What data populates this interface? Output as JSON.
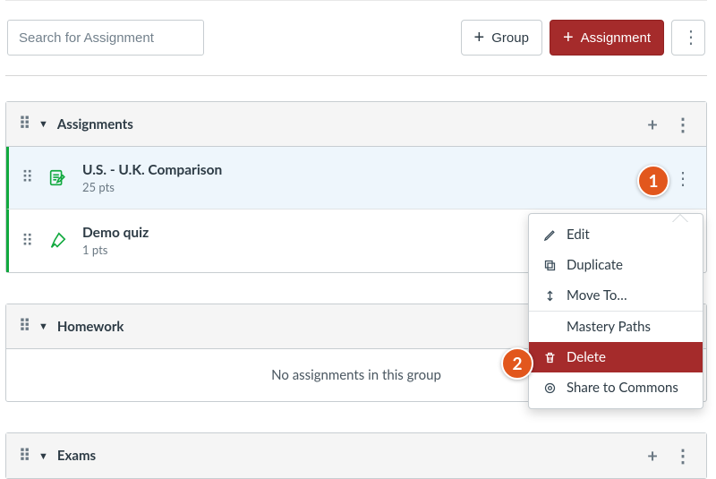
{
  "search": {
    "placeholder": "Search for Assignment"
  },
  "toolbar": {
    "group_label": "Group",
    "assignment_label": "Assignment"
  },
  "groups": [
    {
      "name": "Assignments",
      "empty_text": "",
      "items": [
        {
          "title": "U.S. - U.K. Comparison",
          "pts": "25 pts",
          "kind": "assignment"
        },
        {
          "title": "Demo quiz",
          "pts": "1 pts",
          "kind": "quiz"
        }
      ]
    },
    {
      "name": "Homework",
      "empty_text": "No assignments in this group",
      "items": []
    },
    {
      "name": "Exams",
      "empty_text": "",
      "items": []
    }
  ],
  "menu": {
    "edit": "Edit",
    "duplicate": "Duplicate",
    "move_to": "Move To…",
    "mastery": "Mastery Paths",
    "delete": "Delete",
    "share": "Share to Commons"
  },
  "badges": {
    "one": "1",
    "two": "2"
  }
}
